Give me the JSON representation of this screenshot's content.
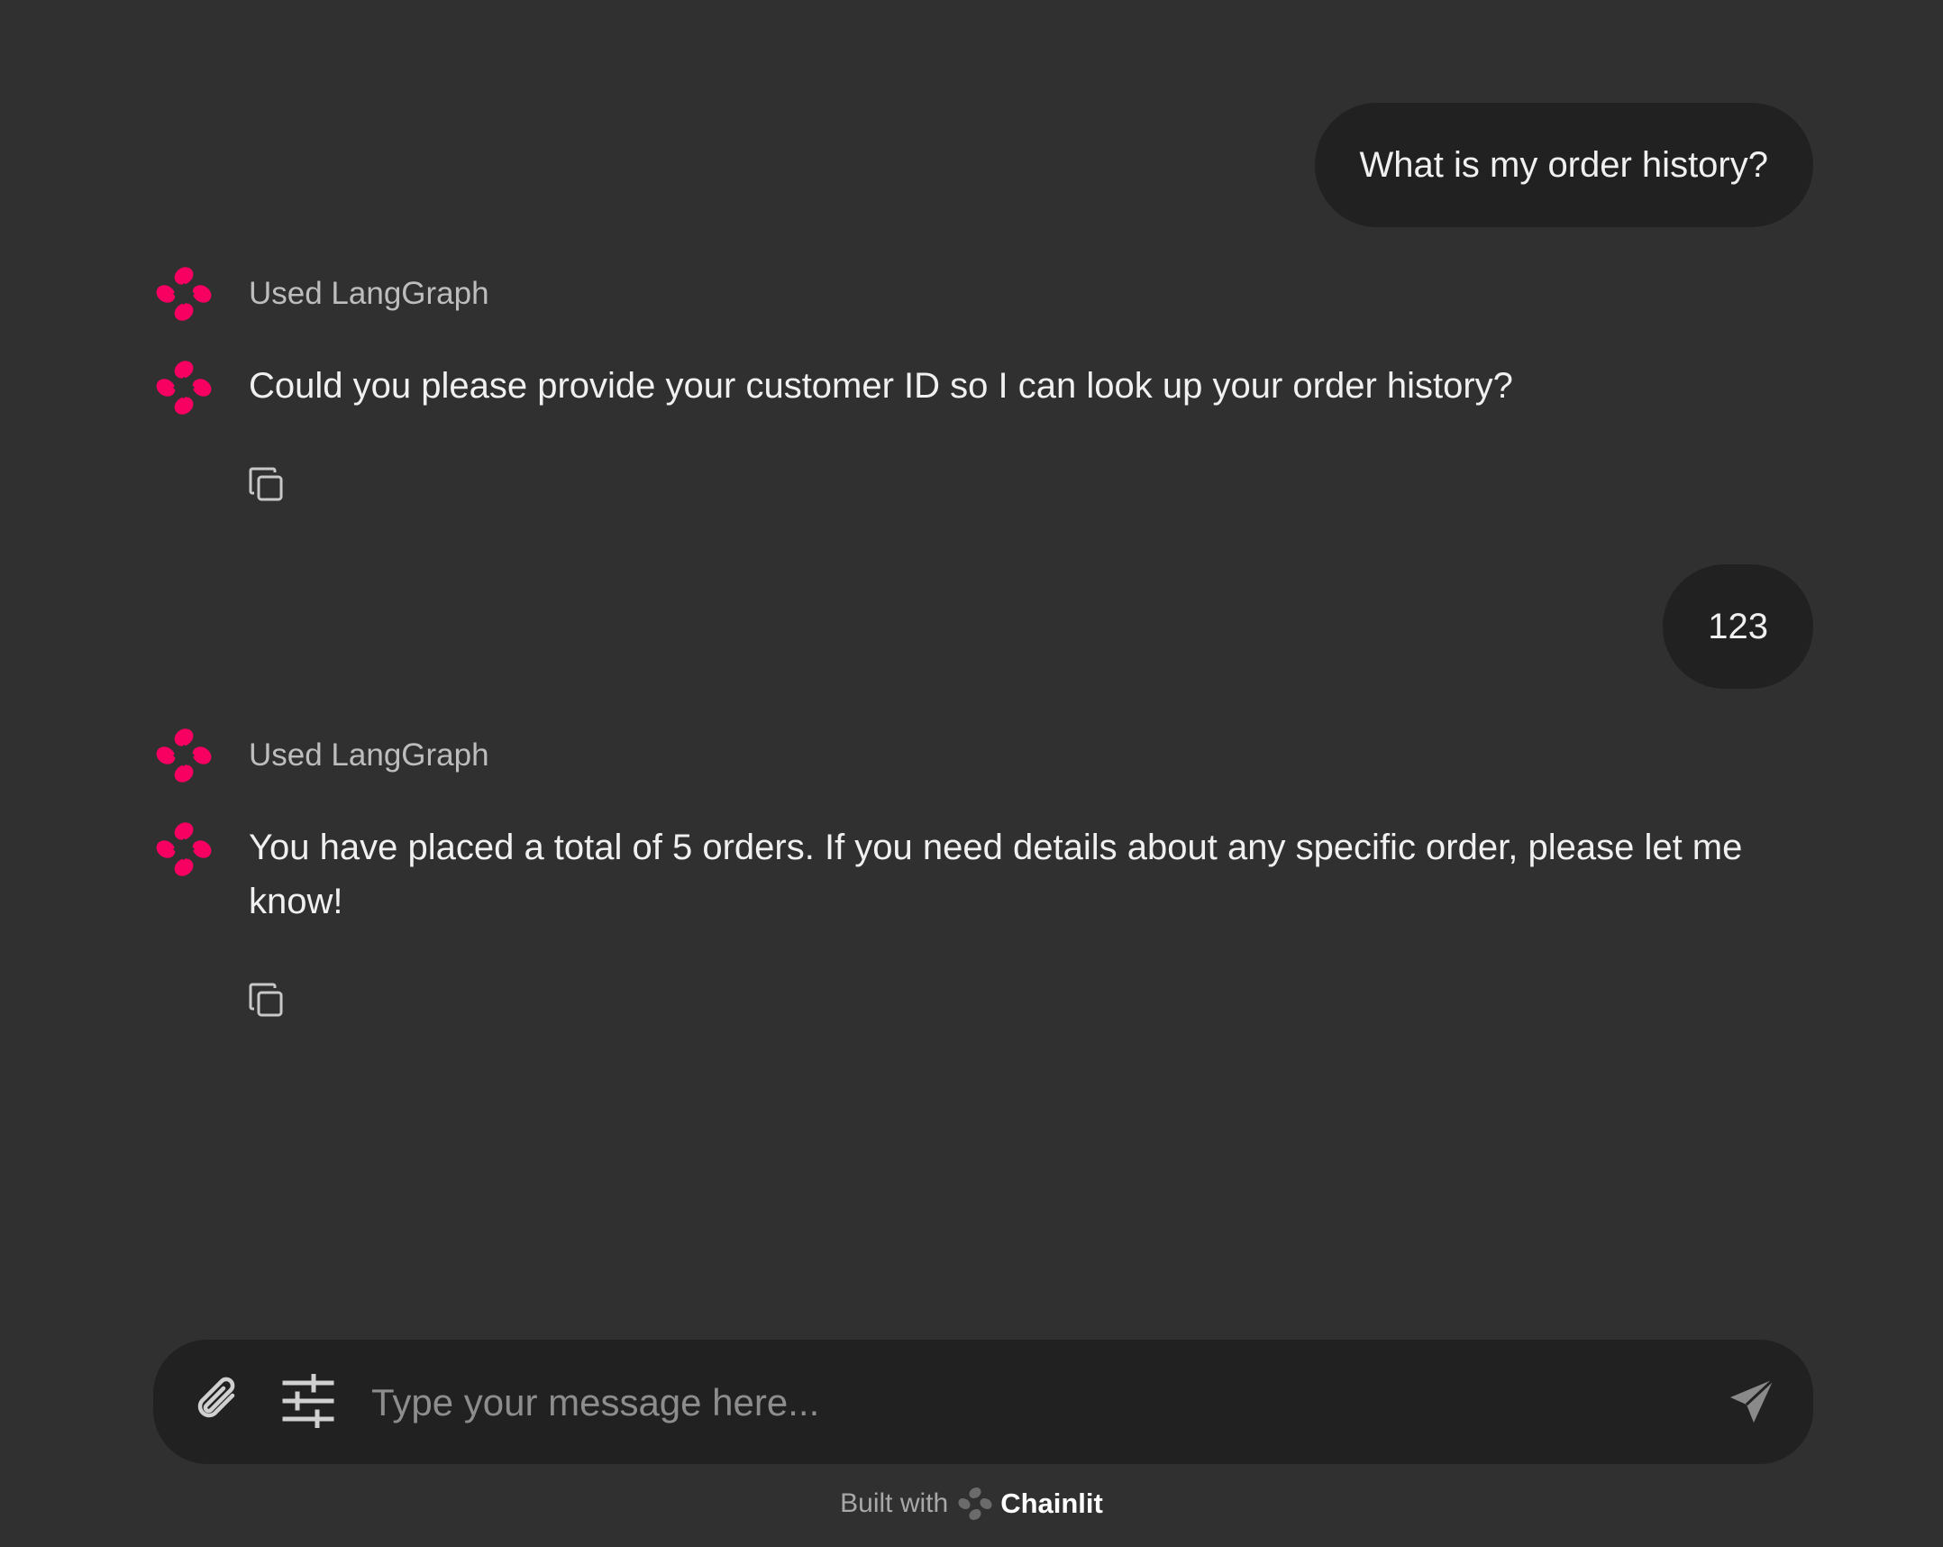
{
  "colors": {
    "background": "#303030",
    "bubble": "#212121",
    "accent": "#F80061",
    "muted_text": "#bdbdbd"
  },
  "messages": {
    "user_1": "What is my order history?",
    "step_1": "Used LangGraph",
    "assistant_1": "Could you please provide your customer ID so I can look up your order history?",
    "user_2": "123",
    "step_2": "Used LangGraph",
    "assistant_2": "You have placed a total of 5 orders. If you need details about any specific order, please let me know!"
  },
  "icons": {
    "avatar": "langgraph-logo-icon",
    "copy": "copy-icon",
    "attach": "paperclip-icon",
    "settings": "sliders-icon",
    "send": "send-icon"
  },
  "composer": {
    "placeholder": "Type your message here..."
  },
  "footer": {
    "built_with": "Built with",
    "brand": "Chainlit"
  }
}
